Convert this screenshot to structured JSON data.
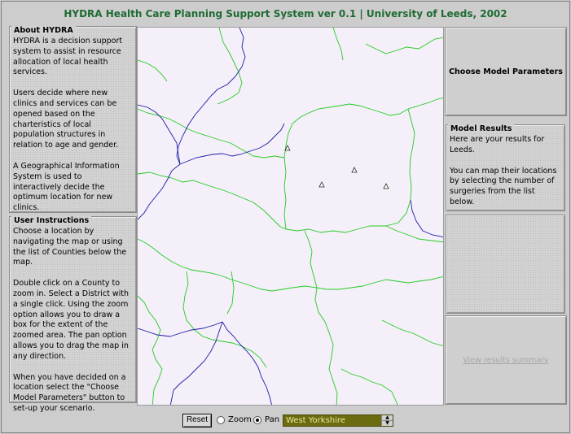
{
  "title": "HYDRA Health Care Planning Support System ver 0.1 | University of Leeds, 2002",
  "about": {
    "heading": "About HYDRA",
    "paragraphs": [
      "HYDRA is a decision support system to assist in resource allocation of local health services.",
      "Users decide where new clinics and services can be opened based on the charteristics of local population structures in relation to age and gender.",
      "A Geographical Information System is used to interactively decide the optimum location for new clinics."
    ]
  },
  "instructions": {
    "heading": "User Instructions",
    "paragraphs": [
      "Choose a location by navigating the map or using the list of Counties below the map.",
      "Double click on a County to zoom in. Select a District with a single click. Using the zoom option allows you to draw a box for the extent of the zoomed area. The pan option allows you to drag the map in any direction.",
      "When you have decided on a location select the \"Choose Model Parameters\" button to set-up your scenario."
    ]
  },
  "right": {
    "choose_label": "Choose Model Parameters",
    "results_heading": "Model Results",
    "results_paragraphs": [
      "Here are your results for Leeds.",
      "You can map their locations by selecting the number of surgeries from the list below."
    ],
    "summary_label": "View results summary"
  },
  "controls": {
    "reset_label": "Reset",
    "zoom_label": "Zoom",
    "pan_label": "Pan",
    "selected_mode": "pan",
    "county_value": "West Yorkshire"
  },
  "colors": {
    "title": "#1e6b33",
    "map_background": "#f4eff8",
    "county_border": "#1c1ca8",
    "district_border": "#22cc22",
    "select_background": "#6b6b10"
  }
}
